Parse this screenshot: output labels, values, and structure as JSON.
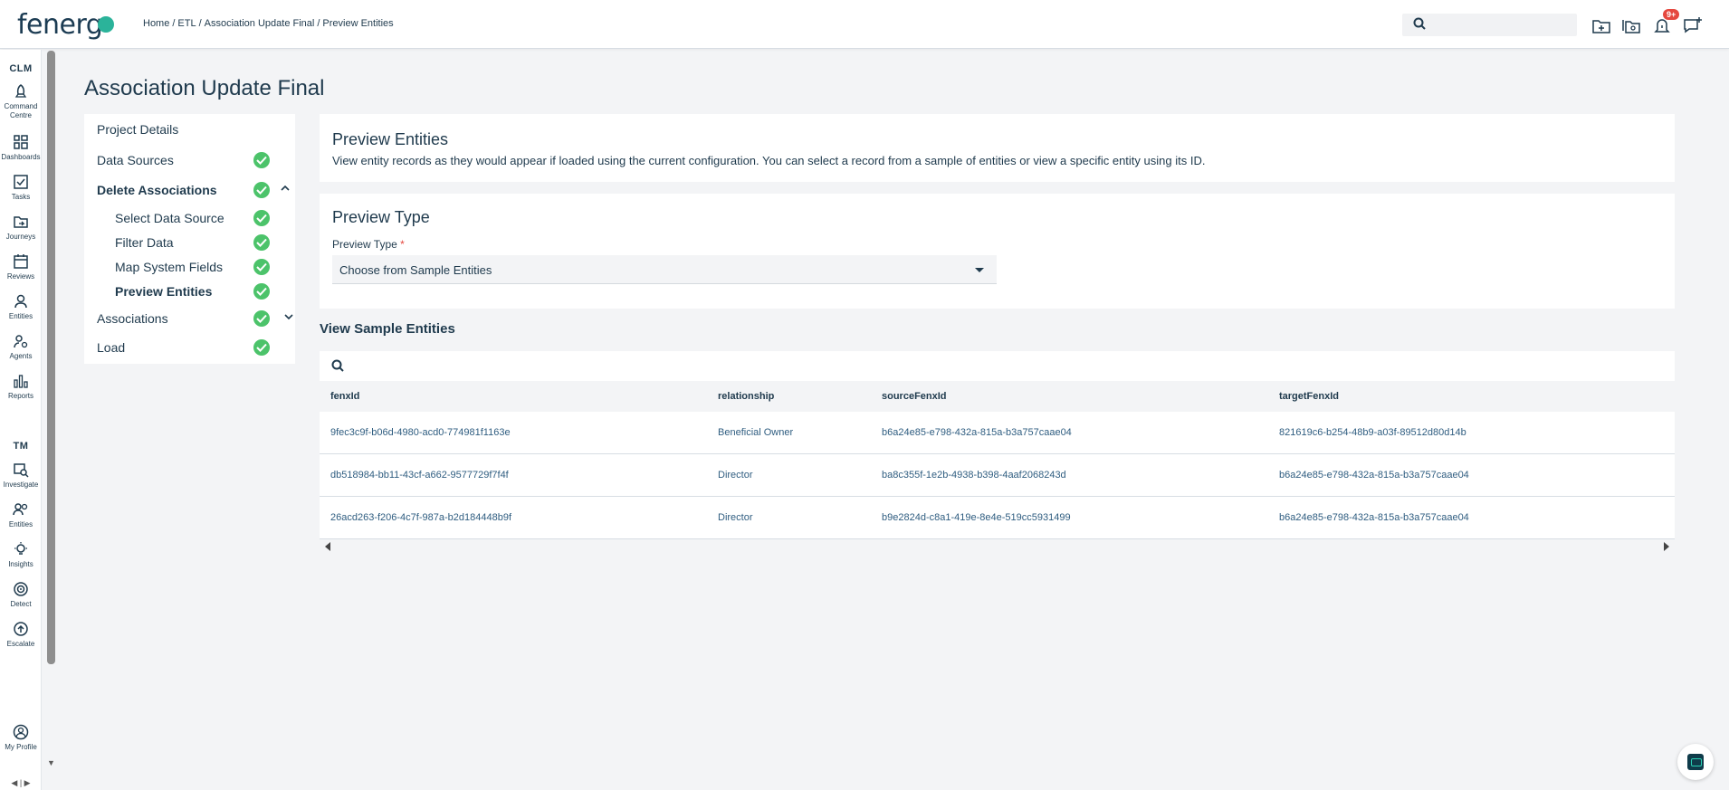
{
  "app": {
    "logo_text": "fenerg"
  },
  "breadcrumb": [
    "Home",
    "ETL",
    "Association Update Final",
    "Preview Entities"
  ],
  "breadcrumb_sep": "/",
  "header": {
    "search_placeholder": "",
    "notifications_badge": "9+"
  },
  "rail": {
    "section_clm": "CLM",
    "clm_items": [
      {
        "label1": "Command",
        "label2": "Centre",
        "icon": "rocket-icon"
      },
      {
        "label1": "Dashboards",
        "label2": "",
        "icon": "dashboard-icon"
      },
      {
        "label1": "Tasks",
        "label2": "",
        "icon": "tasks-icon"
      },
      {
        "label1": "Journeys",
        "label2": "",
        "icon": "journeys-icon"
      },
      {
        "label1": "Reviews",
        "label2": "",
        "icon": "calendar-icon"
      },
      {
        "label1": "Entities",
        "label2": "",
        "icon": "user-icon"
      },
      {
        "label1": "Agents",
        "label2": "",
        "icon": "agents-icon"
      },
      {
        "label1": "Reports",
        "label2": "",
        "icon": "bar-chart-icon"
      }
    ],
    "section_tm": "TM",
    "tm_items": [
      {
        "label1": "Investigate",
        "icon": "investigate-icon"
      },
      {
        "label1": "Entities",
        "icon": "users-icon"
      },
      {
        "label1": "Insights",
        "icon": "lightbulb-icon"
      },
      {
        "label1": "Detect",
        "icon": "target-icon"
      },
      {
        "label1": "Escalate",
        "icon": "escalate-icon"
      }
    ],
    "profile_label": "My Profile"
  },
  "page": {
    "title": "Association Update Final"
  },
  "steps": [
    {
      "label": "Project Details",
      "level": 0,
      "checked": false,
      "bold": false,
      "chevron": ""
    },
    {
      "label": "Data Sources",
      "level": 0,
      "checked": true,
      "bold": false,
      "chevron": ""
    },
    {
      "label": "Delete Associations",
      "level": 0,
      "checked": true,
      "bold": true,
      "chevron": "up"
    },
    {
      "label": "Select Data Source",
      "level": 1,
      "checked": true,
      "bold": false,
      "chevron": ""
    },
    {
      "label": "Filter Data",
      "level": 1,
      "checked": true,
      "bold": false,
      "chevron": ""
    },
    {
      "label": "Map System Fields",
      "level": 1,
      "checked": true,
      "bold": false,
      "chevron": ""
    },
    {
      "label": "Preview Entities",
      "level": 1,
      "checked": true,
      "bold": true,
      "chevron": ""
    },
    {
      "label": "Associations",
      "level": 0,
      "checked": true,
      "bold": false,
      "chevron": "down"
    },
    {
      "label": "Load",
      "level": 0,
      "checked": true,
      "bold": false,
      "chevron": ""
    }
  ],
  "preview_card": {
    "title": "Preview Entities",
    "description": "View entity records as they would appear if loaded using the current configuration. You can select a record from a sample of entities or view a specific entity using its ID."
  },
  "type_card": {
    "title": "Preview Type",
    "field_label": "Preview Type",
    "required_mark": "*",
    "selected_value": "Choose from Sample Entities"
  },
  "sample": {
    "title": "View Sample Entities",
    "columns": [
      "fenxId",
      "relationship",
      "sourceFenxId",
      "targetFenxId"
    ],
    "rows": [
      [
        "9fec3c9f-b06d-4980-acd0-774981f1163e",
        "Beneficial Owner",
        "b6a24e85-e798-432a-815a-b3a757caae04",
        "821619c6-b254-48b9-a03f-89512d80d14b"
      ],
      [
        "db518984-bb11-43cf-a662-9577729f7f4f",
        "Director",
        "ba8c355f-1e2b-4938-b398-4aaf2068243d",
        "b6a24e85-e798-432a-815a-b3a757caae04"
      ],
      [
        "26acd263-f206-4c7f-987a-b2d184448b9f",
        "Director",
        "b9e2824d-c8a1-419e-8e4e-519cc5931499",
        "b6a24e85-e798-432a-815a-b3a757caae04"
      ]
    ]
  }
}
